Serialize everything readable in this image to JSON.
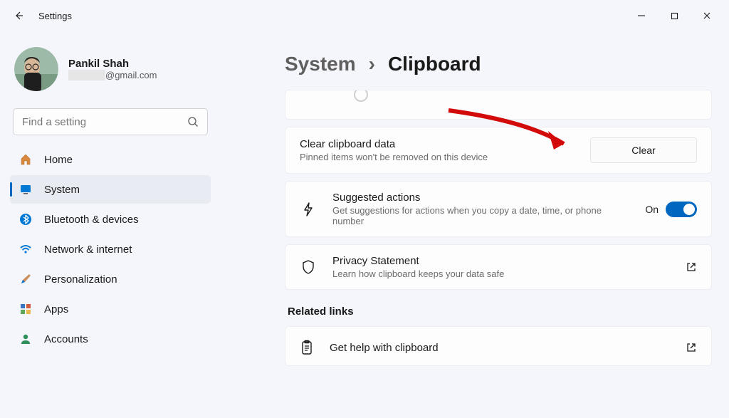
{
  "window": {
    "title": "Settings"
  },
  "profile": {
    "name": "Pankil Shah",
    "email": "@gmail.com"
  },
  "search": {
    "placeholder": "Find a setting"
  },
  "nav": {
    "home": {
      "label": "Home"
    },
    "system": {
      "label": "System"
    },
    "bt": {
      "label": "Bluetooth & devices"
    },
    "net": {
      "label": "Network & internet"
    },
    "pers": {
      "label": "Personalization"
    },
    "apps": {
      "label": "Apps"
    },
    "acc": {
      "label": "Accounts"
    }
  },
  "breadcrumb": {
    "parent": "System",
    "sep": "›",
    "current": "Clipboard"
  },
  "clear": {
    "title": "Clear clipboard data",
    "sub": "Pinned items won't be removed on this device",
    "button": "Clear"
  },
  "suggested": {
    "title": "Suggested actions",
    "sub": "Get suggestions for actions when you copy a date, time, or phone number",
    "state": "On"
  },
  "privacy": {
    "title": "Privacy Statement",
    "sub": "Learn how clipboard keeps your data safe"
  },
  "related": {
    "heading": "Related links",
    "help": "Get help with clipboard"
  }
}
